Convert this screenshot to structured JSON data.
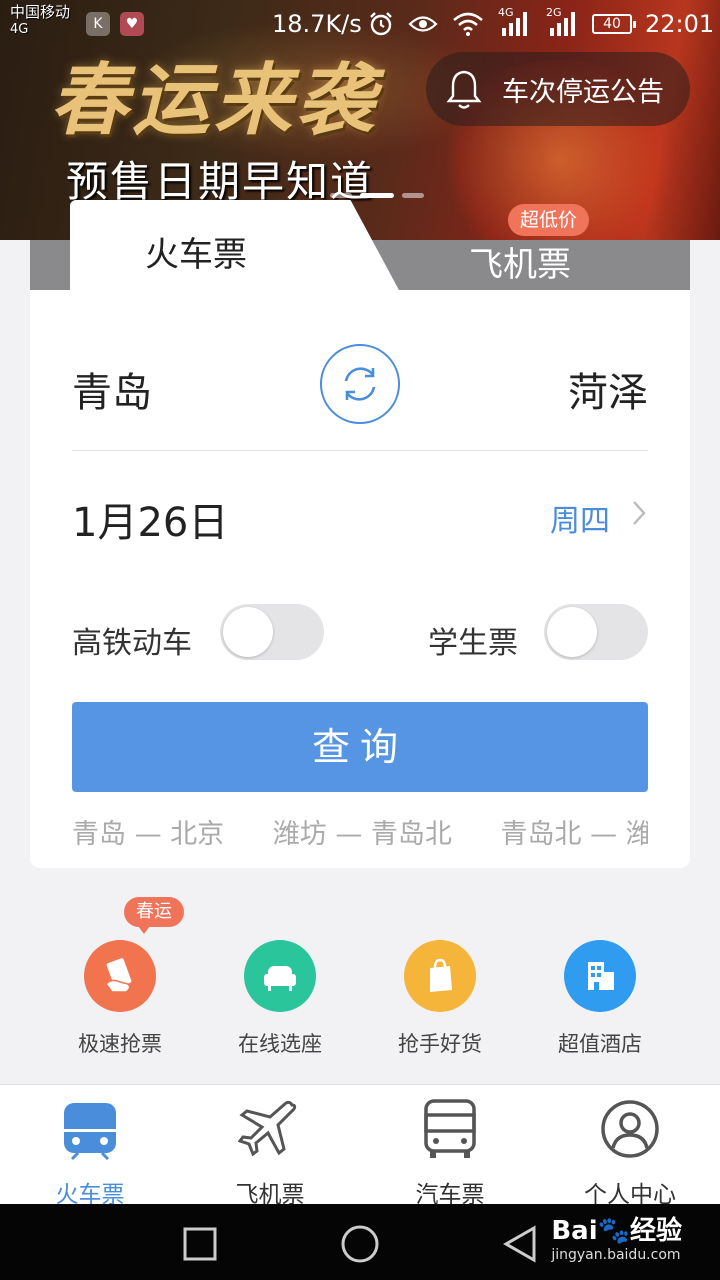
{
  "status_bar": {
    "carrier_line1": "中国移动",
    "carrier_line2": "4G",
    "speed": "18.7K/s",
    "network1": "4G",
    "network2": "2G",
    "battery": "40",
    "time": "22:01"
  },
  "banner": {
    "title": "春运来袭",
    "subtitle": "预售日期早知道",
    "notice_label": "车次停运公告"
  },
  "tabs": {
    "train": "火车票",
    "plane": "飞机票",
    "plane_badge": "超低价"
  },
  "search": {
    "from": "青岛",
    "to": "菏泽",
    "date": "1月26日",
    "weekday": "周四",
    "high_speed_label": "高铁动车",
    "high_speed_on": false,
    "student_label": "学生票",
    "student_on": false,
    "query_button": "查询",
    "history": [
      "青岛 — 北京",
      "潍坊 — 青岛北",
      "青岛北 — 潍"
    ]
  },
  "quick_actions": {
    "badge": "春运",
    "items": [
      {
        "label": "极速抢票",
        "icon": "ticket-hand-icon",
        "color": "#f2744f"
      },
      {
        "label": "在线选座",
        "icon": "seat-icon",
        "color": "#2bc59c"
      },
      {
        "label": "抢手好货",
        "icon": "shopping-bag-icon",
        "color": "#f5b53a"
      },
      {
        "label": "超值酒店",
        "icon": "hotel-icon",
        "color": "#2f9cf0"
      }
    ]
  },
  "bottom_nav": {
    "items": [
      {
        "label": "火车票",
        "icon": "train-icon"
      },
      {
        "label": "飞机票",
        "icon": "airplane-icon"
      },
      {
        "label": "汽车票",
        "icon": "bus-icon"
      },
      {
        "label": "个人中心",
        "icon": "user-icon"
      }
    ],
    "active_color": "#4a8edb"
  },
  "watermark": {
    "main": "Bai🐾经验",
    "sub": "jingyan.baidu.com"
  }
}
